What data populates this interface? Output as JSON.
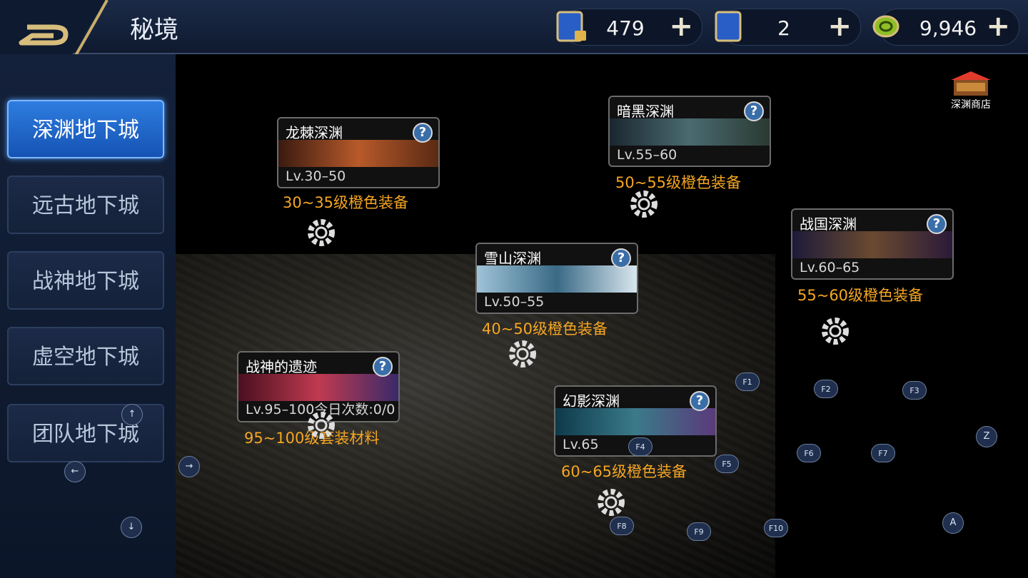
{
  "header": {
    "title": "秘境"
  },
  "resources": [
    {
      "value": "479",
      "icon": "locked-ticket-icon"
    },
    {
      "value": "2",
      "icon": "ticket-icon"
    },
    {
      "value": "9,946",
      "icon": "coin-icon"
    }
  ],
  "plus_label": "+",
  "tabs": [
    {
      "label": "深渊地下城",
      "active": true
    },
    {
      "label": "远古地下城"
    },
    {
      "label": "战神地下城"
    },
    {
      "label": "虚空地下城"
    },
    {
      "label": "团队地下城"
    }
  ],
  "shop": {
    "label": "深渊商店"
  },
  "dungeons": [
    {
      "name": "龙棘深渊",
      "level": "Lv.30–50",
      "reward": "30~35级橙色装备"
    },
    {
      "name": "暗黑深渊",
      "level": "Lv.55–60",
      "reward": "50~55级橙色装备"
    },
    {
      "name": "战国深渊",
      "level": "Lv.60–65",
      "reward": "55~60级橙色装备"
    },
    {
      "name": "雪山深渊",
      "level": "Lv.50–55",
      "reward": "40~50级橙色装备"
    },
    {
      "name": "战神的遗迹",
      "level": "Lv.95–100今日次数:0/0",
      "reward": "95~100级套装材料"
    },
    {
      "name": "幻影深渊",
      "level": "Lv.65",
      "reward": "60~65级橙色装备"
    }
  ],
  "help_label": "?",
  "keys": [
    "F1",
    "F2",
    "F3",
    "F4",
    "F5",
    "F6",
    "F7",
    "F8",
    "F9",
    "F10",
    "Z",
    "A"
  ],
  "arrows": {
    "up": "↑",
    "left": "←",
    "right": "→",
    "down": "↓"
  },
  "colors": {
    "accent": "#2e7de0",
    "reward": "#f5a623",
    "topbar": "#1b2a47"
  }
}
